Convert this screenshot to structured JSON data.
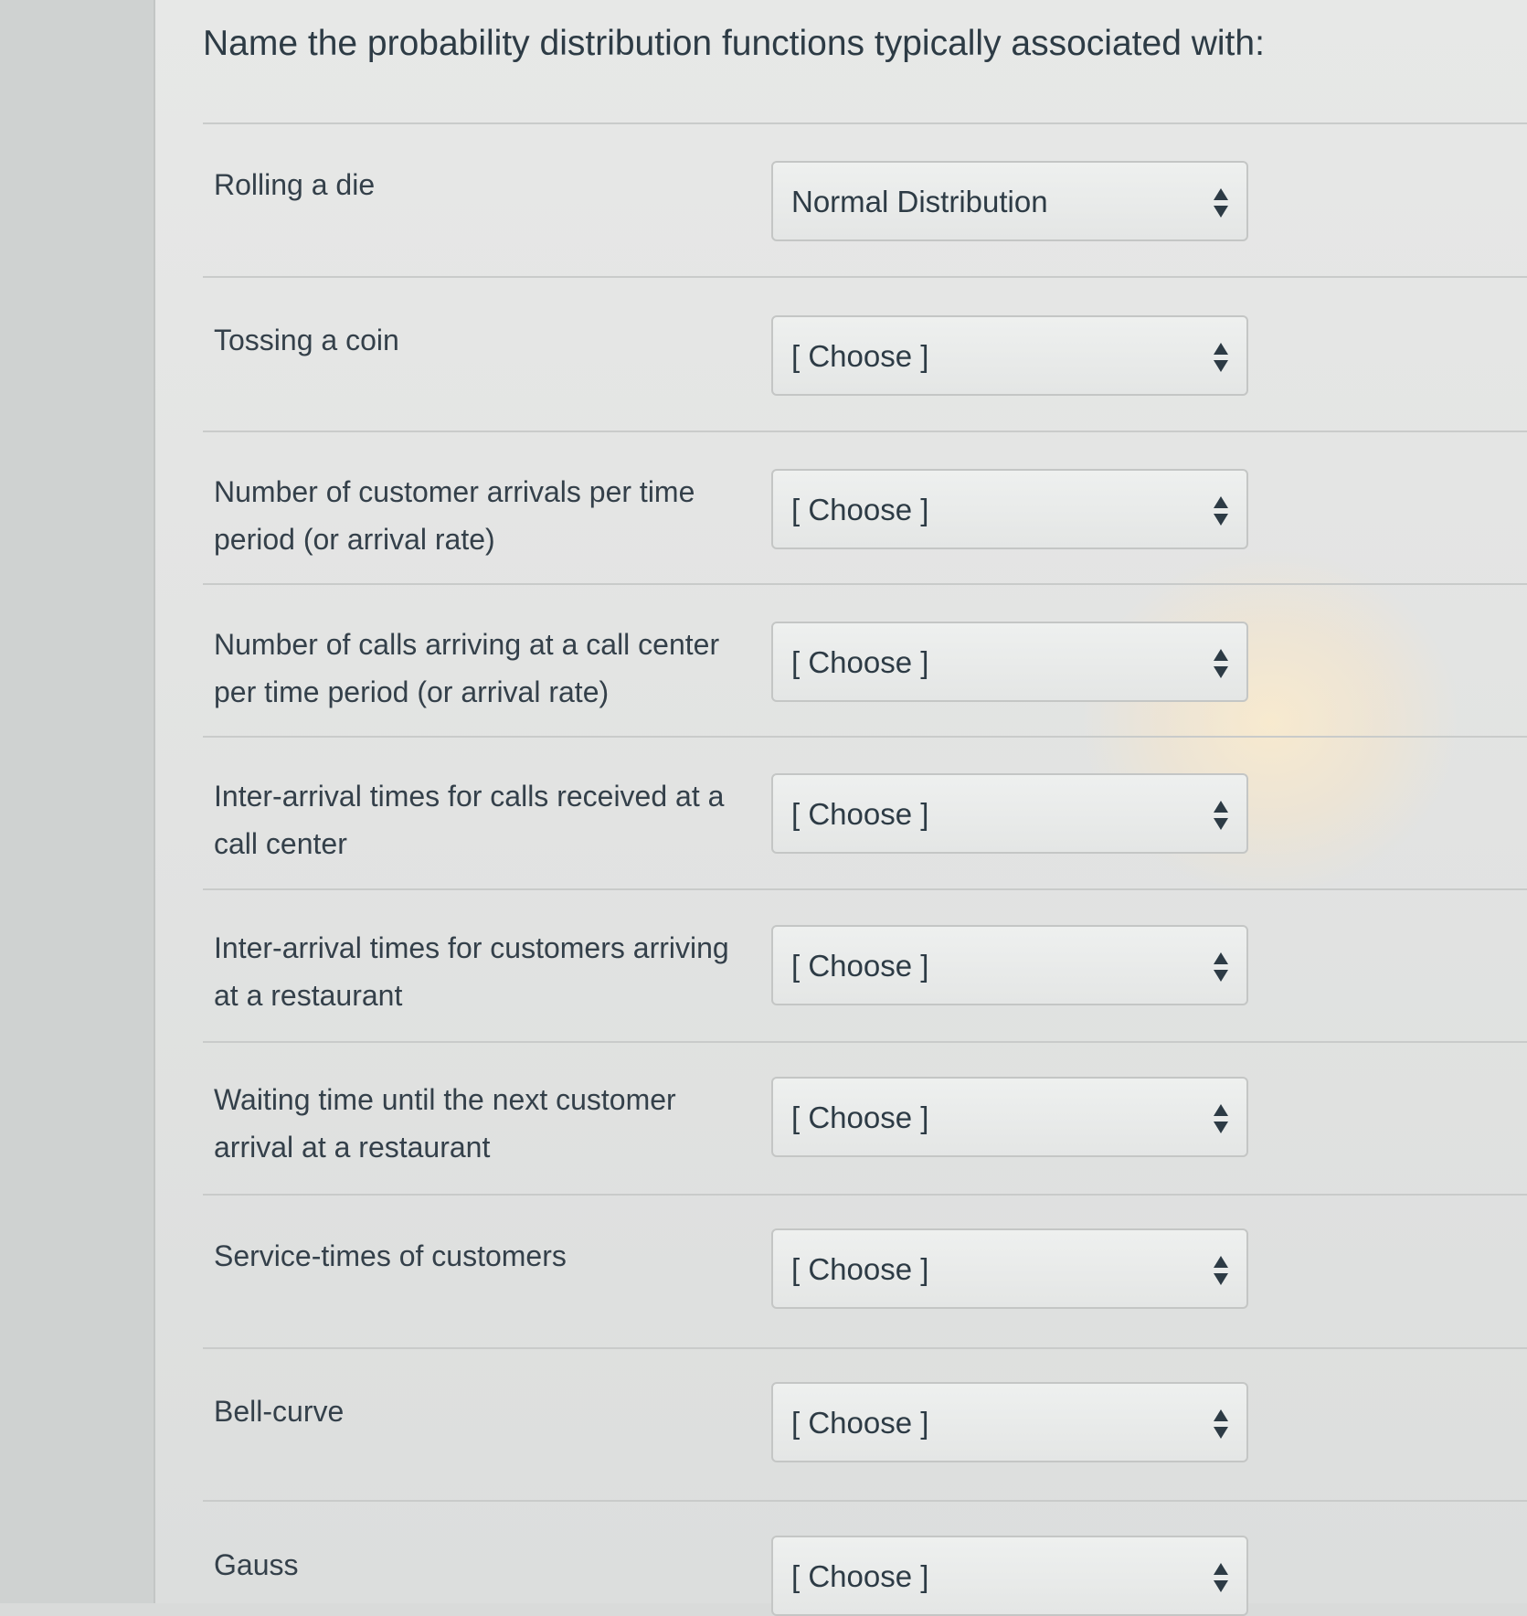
{
  "question": {
    "title": "Name the probability distribution functions typically associated with:"
  },
  "rows": [
    {
      "label": "Rolling a die",
      "selected": "Normal Distribution"
    },
    {
      "label": "Tossing a coin",
      "selected": "[ Choose ]"
    },
    {
      "label": "Number of customer arrivals per time period (or arrival rate)",
      "selected": "[ Choose ]"
    },
    {
      "label": "Number of calls arriving at a call center per time period (or arrival rate)",
      "selected": "[ Choose ]"
    },
    {
      "label": "Inter-arrival times for calls received at a call center",
      "selected": "[ Choose ]"
    },
    {
      "label": "Inter-arrival times for customers arriving at a restaurant",
      "selected": "[ Choose ]"
    },
    {
      "label": "Waiting time until the next customer arrival at a restaurant",
      "selected": "[ Choose ]"
    },
    {
      "label": "Service-times of customers",
      "selected": "[ Choose ]"
    },
    {
      "label": "Bell-curve",
      "selected": "[ Choose ]"
    },
    {
      "label": "Gauss",
      "selected": "[ Choose ]"
    }
  ],
  "icons": {
    "select_arrow": "up-down-arrows-icon"
  }
}
